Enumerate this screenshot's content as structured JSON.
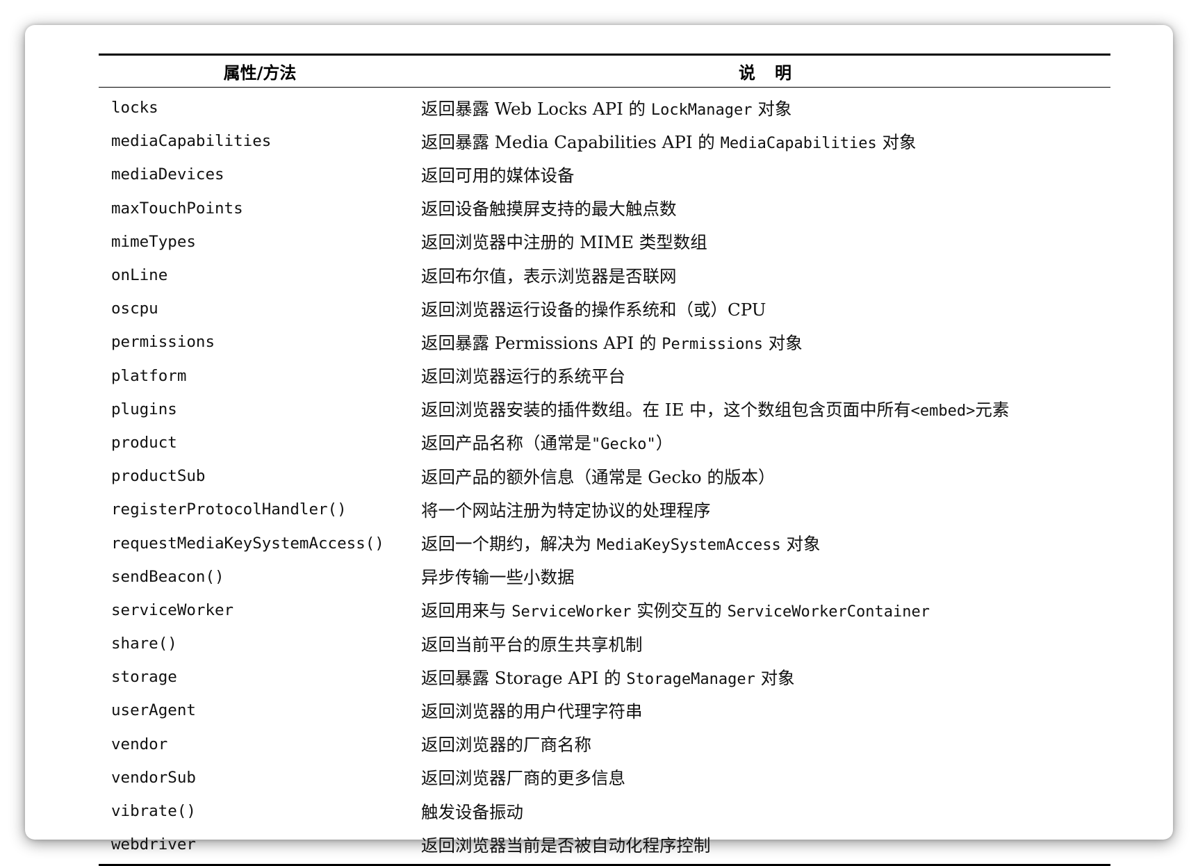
{
  "table": {
    "header": {
      "property": "属性/方法",
      "description": "说　明"
    },
    "rows": [
      {
        "property": "locks",
        "description": [
          {
            "t": "返回暴露 Web Locks API 的 "
          },
          {
            "c": "LockManager"
          },
          {
            "t": " 对象"
          }
        ]
      },
      {
        "property": "mediaCapabilities",
        "description": [
          {
            "t": "返回暴露 Media Capabilities API 的 "
          },
          {
            "c": "MediaCapabilities"
          },
          {
            "t": " 对象"
          }
        ]
      },
      {
        "property": "mediaDevices",
        "description": [
          {
            "t": "返回可用的媒体设备"
          }
        ]
      },
      {
        "property": "maxTouchPoints",
        "description": [
          {
            "t": "返回设备触摸屏支持的最大触点数"
          }
        ]
      },
      {
        "property": "mimeTypes",
        "description": [
          {
            "t": "返回浏览器中注册的 MIME 类型数组"
          }
        ]
      },
      {
        "property": "onLine",
        "description": [
          {
            "t": "返回布尔值，表示浏览器是否联网"
          }
        ]
      },
      {
        "property": "oscpu",
        "description": [
          {
            "t": "返回浏览器运行设备的操作系统和（或）CPU"
          }
        ]
      },
      {
        "property": "permissions",
        "description": [
          {
            "t": "返回暴露 Permissions API 的 "
          },
          {
            "c": "Permissions"
          },
          {
            "t": " 对象"
          }
        ]
      },
      {
        "property": "platform",
        "description": [
          {
            "t": "返回浏览器运行的系统平台"
          }
        ]
      },
      {
        "property": "plugins",
        "description": [
          {
            "t": "返回浏览器安装的插件数组。在 IE 中，这个数组包含页面中所有"
          },
          {
            "c": "<embed>"
          },
          {
            "t": "元素"
          }
        ]
      },
      {
        "property": "product",
        "description": [
          {
            "t": "返回产品名称（通常是"
          },
          {
            "c": "\"Gecko\""
          },
          {
            "t": "）"
          }
        ]
      },
      {
        "property": "productSub",
        "description": [
          {
            "t": "返回产品的额外信息（通常是 Gecko 的版本）"
          }
        ]
      },
      {
        "property": "registerProtocolHandler()",
        "description": [
          {
            "t": "将一个网站注册为特定协议的处理程序"
          }
        ]
      },
      {
        "property": "requestMediaKeySystemAccess()",
        "description": [
          {
            "t": "返回一个期约，解决为 "
          },
          {
            "c": "MediaKeySystemAccess"
          },
          {
            "t": " 对象"
          }
        ]
      },
      {
        "property": "sendBeacon()",
        "description": [
          {
            "t": "异步传输一些小数据"
          }
        ]
      },
      {
        "property": "serviceWorker",
        "description": [
          {
            "t": "返回用来与 "
          },
          {
            "c": "ServiceWorker"
          },
          {
            "t": " 实例交互的 "
          },
          {
            "c": "ServiceWorkerContainer"
          }
        ]
      },
      {
        "property": "share()",
        "description": [
          {
            "t": "返回当前平台的原生共享机制"
          }
        ]
      },
      {
        "property": "storage",
        "description": [
          {
            "t": "返回暴露 Storage API 的 "
          },
          {
            "c": "StorageManager"
          },
          {
            "t": " 对象"
          }
        ]
      },
      {
        "property": "userAgent",
        "description": [
          {
            "t": "返回浏览器的用户代理字符串"
          }
        ]
      },
      {
        "property": "vendor",
        "description": [
          {
            "t": "返回浏览器的厂商名称"
          }
        ]
      },
      {
        "property": "vendorSub",
        "description": [
          {
            "t": "返回浏览器厂商的更多信息"
          }
        ]
      },
      {
        "property": "vibrate()",
        "description": [
          {
            "t": "触发设备振动"
          }
        ]
      },
      {
        "property": "webdriver",
        "description": [
          {
            "t": "返回浏览器当前是否被自动化程序控制"
          }
        ]
      }
    ]
  }
}
